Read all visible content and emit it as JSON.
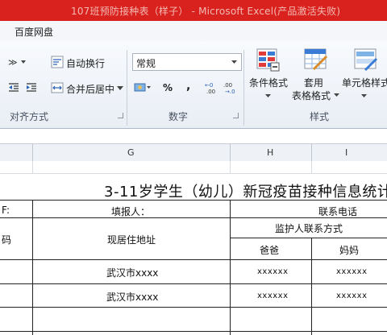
{
  "window": {
    "title": "107班预防接种表（样子） - Microsoft Excel(产品激活失败)"
  },
  "menubar": {
    "baidu_netdisk": "百度网盘"
  },
  "ribbon": {
    "wrap_text": "自动换行",
    "merge_center": "合并后居中",
    "number_format": "常规",
    "percent": "%",
    "comma": ",",
    "conditional_format": "条件格式",
    "table_format_1": "套用",
    "table_format_2": "表格格式",
    "cell_styles": "单元格样式",
    "group_alignment": "对齐方式",
    "group_number": "数字",
    "group_styles": "样式"
  },
  "columns": {
    "g": "G",
    "h": "H",
    "i": "I"
  },
  "sheet": {
    "title": "3-11岁学生（幼儿）新冠疫苗接种信息统计",
    "left_partial_1": "F:",
    "filler_label": "填报人：",
    "contact_phone": "联系电话",
    "left_partial_2": "码",
    "address_header": "现居住地址",
    "guardian_contact": "监护人联系方式",
    "father": "爸爸",
    "mother": "妈妈",
    "rows": [
      {
        "address": "武汉市xxxx",
        "father": "xxxxxx",
        "mother": "xxxxxx"
      },
      {
        "address": "武汉市xxxx",
        "father": "xxxxxx",
        "mother": "xxxxxx"
      }
    ]
  }
}
